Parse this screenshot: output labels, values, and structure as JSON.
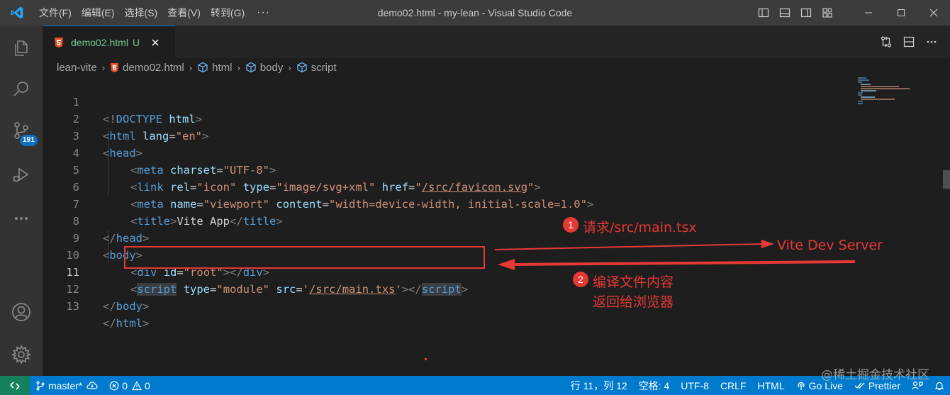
{
  "titlebar": {
    "menus": [
      "文件(F)",
      "编辑(E)",
      "选择(S)",
      "查看(V)",
      "转到(G)"
    ],
    "more": "···",
    "window_title": "demo02.html - my-lean - Visual Studio Code"
  },
  "activity": {
    "source_control_badge": "191"
  },
  "tab": {
    "label": "demo02.html",
    "status": "U"
  },
  "breadcrumb": {
    "items": [
      "lean-vite",
      "demo02.html",
      "html",
      "body",
      "script"
    ]
  },
  "editor": {
    "line_numbers": [
      "1",
      "2",
      "3",
      "4",
      "5",
      "6",
      "7",
      "8",
      "9",
      "10",
      "11",
      "12",
      "13"
    ],
    "current_line": "11",
    "code": {
      "l1": [
        "<!",
        "DOCTYPE",
        " ",
        "html",
        ">"
      ],
      "l2": [
        "<",
        "html",
        " ",
        "lang",
        "=",
        "\"en\"",
        ">"
      ],
      "l3": [
        "<",
        "head",
        ">"
      ],
      "l4": [
        "<",
        "meta",
        " ",
        "charset",
        "=",
        "\"UTF-8\"",
        ">"
      ],
      "l5": [
        "<",
        "link",
        " ",
        "rel",
        "=",
        "\"icon\"",
        " ",
        "type",
        "=",
        "\"image/svg+xml\"",
        " ",
        "href",
        "=",
        "\"",
        "/src/favicon.svg",
        "\"",
        ">"
      ],
      "l6": [
        "<",
        "meta",
        " ",
        "name",
        "=",
        "\"viewport\"",
        " ",
        "content",
        "=",
        "\"width=device-width, initial-scale=1.0\"",
        ">"
      ],
      "l7": [
        "<",
        "title",
        ">",
        "Vite App",
        "</",
        "title",
        ">"
      ],
      "l8": [
        "</",
        "head",
        ">"
      ],
      "l9": [
        "<",
        "body",
        ">"
      ],
      "l10": [
        "<",
        "div",
        " ",
        "id",
        "=",
        "\"root\"",
        "></",
        "div",
        ">"
      ],
      "l11": [
        "<",
        "script",
        " ",
        "type",
        "=",
        "\"module\"",
        " ",
        "src",
        "=",
        "'",
        "/src/main.txs",
        "'",
        "></",
        "script",
        ">"
      ],
      "l12": [
        "</",
        "body",
        ">"
      ],
      "l13": [
        "</",
        "html",
        ">"
      ]
    }
  },
  "annotations": {
    "step1_num": "1",
    "step1_text": "请求/src/main.tsx",
    "server_label": "Vite Dev Server",
    "step2_num": "2",
    "step2_line1": "编译文件内容",
    "step2_line2": "返回给浏览器",
    "color": "#e53935"
  },
  "statusbar": {
    "branch": "master*",
    "errors": "0",
    "warnings": "0",
    "cursor": "行 11，列 12",
    "spaces": "空格: 4",
    "encoding": "UTF-8",
    "eol": "CRLF",
    "language": "HTML",
    "live": "Go Live",
    "prettier": "Prettier",
    "watermark": "@稀土掘金技术社区",
    "color": "#007acc"
  }
}
